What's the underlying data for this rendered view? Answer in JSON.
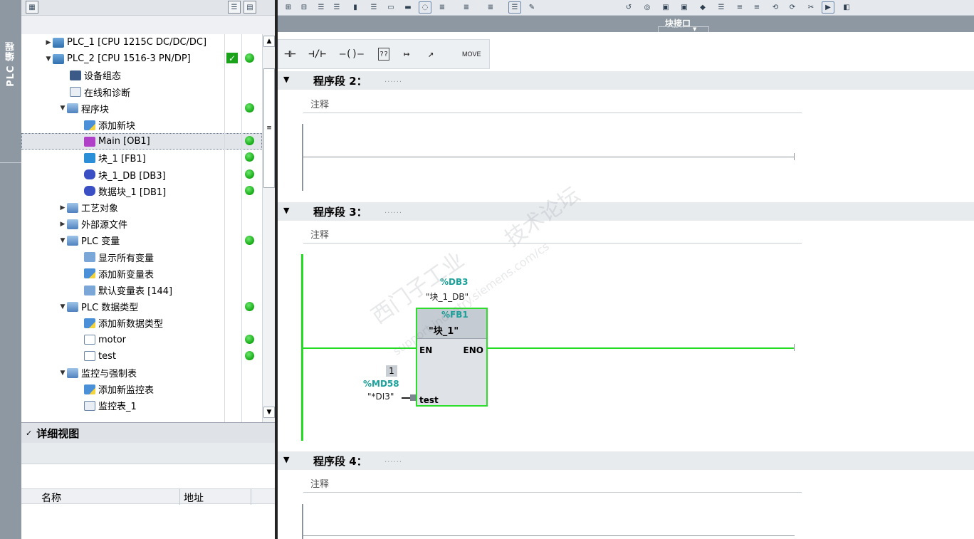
{
  "side_tab": {
    "label": "PLC 编程"
  },
  "tree": {
    "items": [
      {
        "label": "PLC_1 [CPU 1215C DC/DC/DC]",
        "expanded": false
      },
      {
        "label": "PLC_2 [CPU 1516-3 PN/DP]",
        "expanded": true
      },
      {
        "label": "设备组态"
      },
      {
        "label": "在线和诊断"
      },
      {
        "label": "程序块",
        "expanded": true
      },
      {
        "label": "添加新块"
      },
      {
        "label": "Main [OB1]",
        "selected": true
      },
      {
        "label": "块_1 [FB1]"
      },
      {
        "label": "块_1_DB [DB3]"
      },
      {
        "label": "数据块_1 [DB1]"
      },
      {
        "label": "工艺对象",
        "expanded": false
      },
      {
        "label": "外部源文件",
        "expanded": false
      },
      {
        "label": "PLC 变量",
        "expanded": true
      },
      {
        "label": "显示所有变量"
      },
      {
        "label": "添加新变量表"
      },
      {
        "label": "默认变量表 [144]"
      },
      {
        "label": "PLC 数据类型",
        "expanded": true
      },
      {
        "label": "添加新数据类型"
      },
      {
        "label": "motor"
      },
      {
        "label": "test"
      },
      {
        "label": "监控与强制表",
        "expanded": true
      },
      {
        "label": "添加新监控表"
      },
      {
        "label": "监控表_1"
      }
    ],
    "status_colors": {
      "ok": "#13a813",
      "check": "#1aa31a"
    }
  },
  "detail": {
    "title": "详细视图",
    "col_name": "名称",
    "col_address": "地址"
  },
  "editor": {
    "interface_label": "块接口",
    "ladder_tools": [
      "⊣⊢",
      "⊣/⊢",
      "–()–",
      "??",
      "↦",
      "↗",
      "MOVE"
    ],
    "networks": [
      {
        "title": "程序段 2：",
        "dots": "......",
        "comment": "注释"
      },
      {
        "title": "程序段 3：",
        "dots": "......",
        "comment": "注释"
      },
      {
        "title": "程序段 4：",
        "dots": "......",
        "comment": "注释"
      }
    ],
    "fb_call": {
      "instance_address": "%DB3",
      "instance_name": "\"块_1_DB\"",
      "block_address": "%FB1",
      "block_name": "\"块_1\"",
      "en": "EN",
      "eno": "ENO",
      "param_name": "test",
      "param_value": "1",
      "param_address": "%MD58",
      "param_tag": "\"*DI3\""
    },
    "watermark": [
      "西门子工业",
      "技术论坛",
      "support.industry.siemens.com/cs"
    ]
  },
  "colors": {
    "power_flow": "#22dd22",
    "header_gray": "#8e98a3",
    "teal_address": "#1aa19a"
  }
}
